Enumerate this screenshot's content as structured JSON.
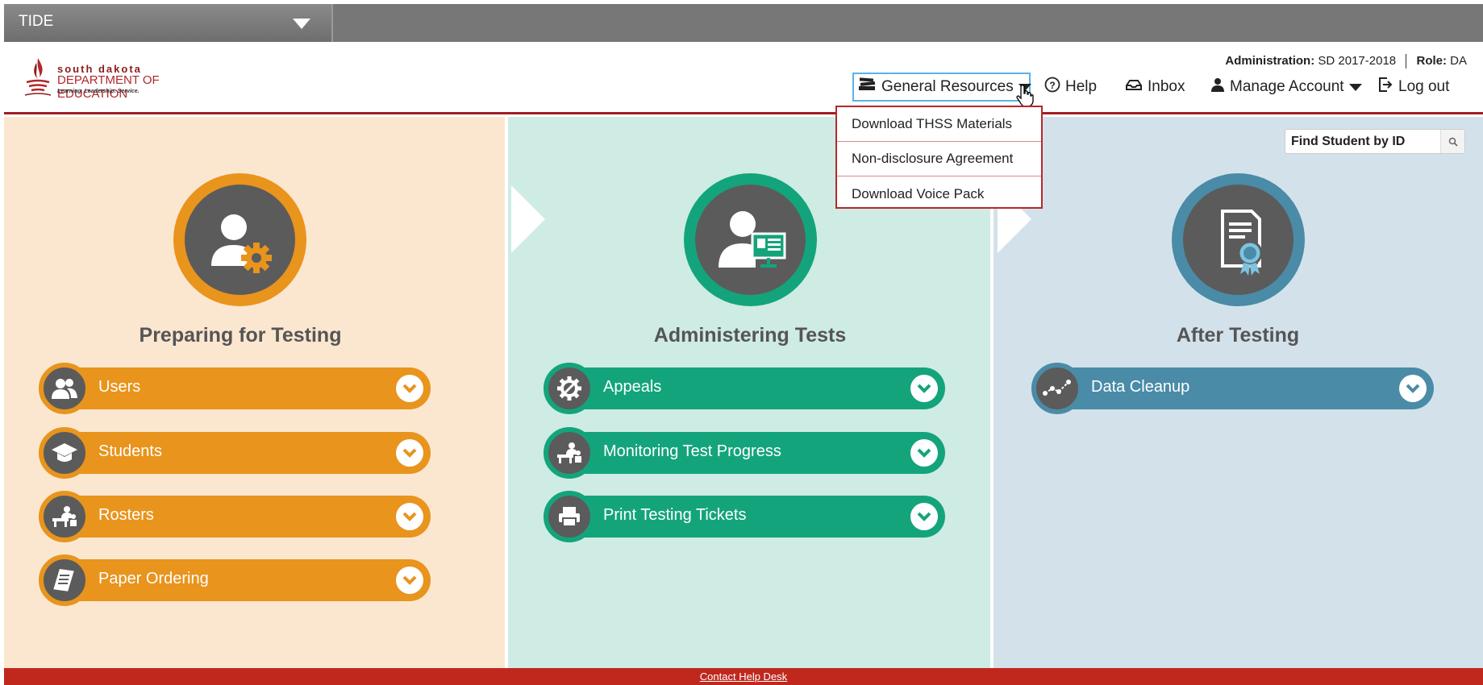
{
  "app": {
    "name": "TIDE"
  },
  "logo": {
    "line1": "south dakota",
    "line2": "DEPARTMENT OF EDUCATION",
    "tagline": "Learning. Leadership. Service."
  },
  "admin_info": {
    "admin_label": "Administration:",
    "admin_value": "SD 2017-2018",
    "role_label": "Role:",
    "role_value": "DA"
  },
  "nav": {
    "general_resources": "General Resources",
    "help": "Help",
    "inbox": "Inbox",
    "manage_account": "Manage Account",
    "logout": "Log out"
  },
  "dropdown": {
    "items": [
      "Download THSS Materials",
      "Non-disclosure Agreement",
      "Download Voice Pack"
    ]
  },
  "search": {
    "placeholder": "Find Student by ID"
  },
  "columns": {
    "prep": {
      "title": "Preparing for Testing",
      "items": [
        "Users",
        "Students",
        "Rosters",
        "Paper Ordering"
      ]
    },
    "admin": {
      "title": "Administering Tests",
      "items": [
        "Appeals",
        "Monitoring Test Progress",
        "Print Testing Tickets"
      ]
    },
    "after": {
      "title": "After Testing",
      "items": [
        "Data Cleanup"
      ]
    }
  },
  "footer": {
    "link": "Contact Help Desk"
  },
  "colors": {
    "orange": "#e8941d",
    "green": "#14a47c",
    "blue": "#4a8ba7",
    "brand_red": "#b0282b"
  }
}
